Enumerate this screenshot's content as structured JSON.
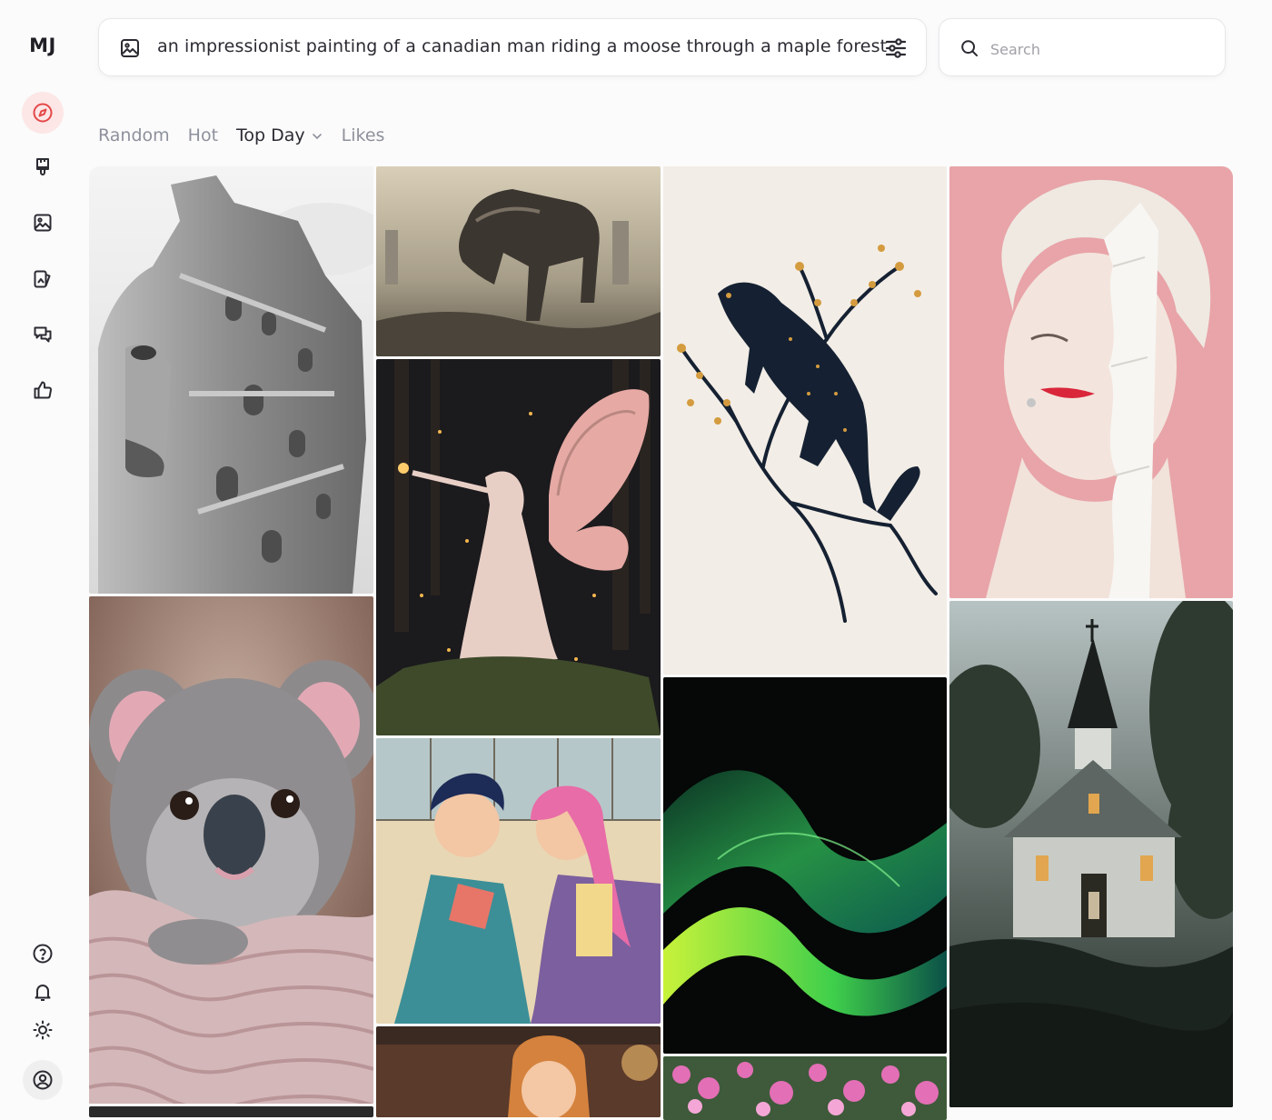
{
  "app": {
    "logo": "MJ"
  },
  "sidebar": {
    "nav": [
      {
        "icon": "compass-icon",
        "active": true
      },
      {
        "icon": "paintbrush-icon"
      },
      {
        "icon": "image-icon"
      },
      {
        "icon": "organize-icon"
      },
      {
        "icon": "chat-icon"
      },
      {
        "icon": "thumbs-up-icon"
      }
    ],
    "bottom": [
      {
        "icon": "help-icon"
      },
      {
        "icon": "bell-icon"
      },
      {
        "icon": "sun-icon"
      },
      {
        "icon": "user-icon"
      }
    ],
    "accent_color": "#e54848"
  },
  "prompt": {
    "value": "an impressionist painting of a canadian man riding a moose through a maple forest"
  },
  "search": {
    "placeholder": "Search",
    "value": ""
  },
  "tabs": [
    {
      "label": "Random",
      "active": false
    },
    {
      "label": "Hot",
      "active": false
    },
    {
      "label": "Top Day",
      "active": true,
      "dropdown": true
    },
    {
      "label": "Likes",
      "active": false
    }
  ],
  "gallery": [
    {
      "name": "stone-face-castle-image",
      "subject": "surreal stone castle face"
    },
    {
      "name": "mechanical-horse-image",
      "subject": "mechanical horse in wasteland"
    },
    {
      "name": "panther-on-branch-image",
      "subject": "black panther on blossoming branch"
    },
    {
      "name": "porcelain-woman-image",
      "subject": "woman with torn paper face"
    },
    {
      "name": "koala-image",
      "subject": "koala in knitted blanket"
    },
    {
      "name": "fairy-image",
      "subject": "fairy with glowing wings"
    },
    {
      "name": "anime-couple-image",
      "subject": "retro anime couple"
    },
    {
      "name": "green-wave-image",
      "subject": "abstract green particle wave"
    },
    {
      "name": "church-image",
      "subject": "old church at dusk"
    },
    {
      "name": "animated-girl-image",
      "subject": "animated girl in bedroom"
    },
    {
      "name": "pink-flowers-image",
      "subject": "pink flowers"
    }
  ]
}
